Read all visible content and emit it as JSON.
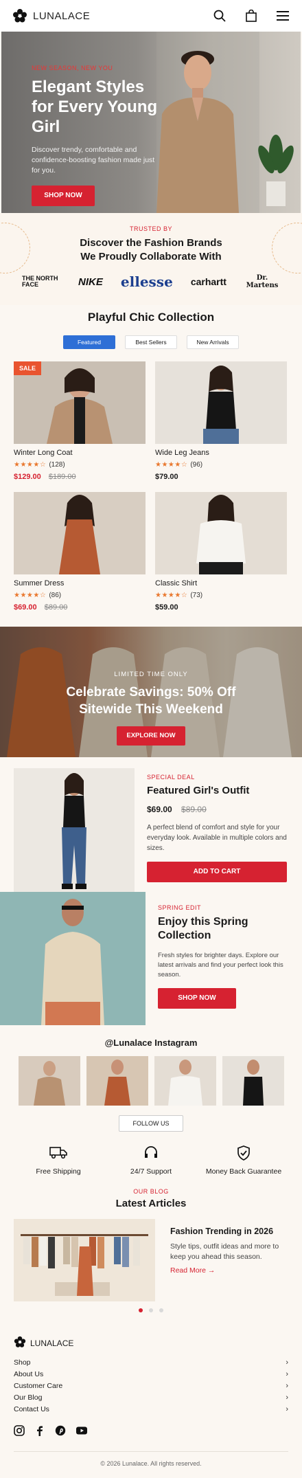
{
  "header": {
    "brand": "LUNALACE",
    "icons": [
      "flower-logo-icon",
      "search-icon",
      "bag-icon",
      "menu-icon"
    ]
  },
  "hero": {
    "eyebrow": "NEW SEASON, NEW YOU",
    "title_line1": "Elegant Styles",
    "title_line2": "for Every Young Girl",
    "description": "Discover trendy, comfortable and confidence-boosting fashion made just for you.",
    "button": "SHOP NOW"
  },
  "brands": {
    "eyebrow": "TRUSTED BY",
    "title_line1": "Discover the Fashion Brands",
    "title_line2": "We Proudly Collaborate With",
    "items": [
      "THE NORTH FACE",
      "NIKE",
      "ellesse",
      "carhartt",
      "Dr. Martens"
    ]
  },
  "collection": {
    "title": "Playful Chic Collection",
    "tabs": [
      "Featured",
      "Best Sellers",
      "New Arrivals"
    ],
    "active_tab": "Featured",
    "products": [
      {
        "name": "Winter Long Coat",
        "rating_count": "(128)",
        "price": "$129.00",
        "old_price": "$189.00",
        "badge": "SALE",
        "stars": 4.5
      },
      {
        "name": "Wide Leg Jeans",
        "rating_count": "(96)",
        "price": "$79.00",
        "old_price": "",
        "badge": "",
        "stars": 4.5
      },
      {
        "name": "Summer Dress",
        "rating_count": "(86)",
        "price": "$69.00",
        "old_price": "$89.00",
        "badge": "",
        "stars": 4.5
      },
      {
        "name": "Classic Shirt",
        "rating_count": "(73)",
        "price": "$59.00",
        "old_price": "",
        "badge": "",
        "stars": 4.5
      }
    ]
  },
  "promo": {
    "eyebrow": "LIMITED TIME ONLY",
    "title_line1": "Celebrate Savings: 50% Off",
    "title_line2": "Sitewide This Weekend",
    "button": "EXPLORE NOW"
  },
  "featured": {
    "eyebrow": "SPECIAL DEAL",
    "title": "Featured Girl's Outfit",
    "price": "$69.00",
    "old_price": "$89.00",
    "description": "A perfect blend of comfort and style for your everyday look. Available in multiple colors and sizes.",
    "button": "ADD TO CART"
  },
  "spring": {
    "eyebrow": "SPRING EDIT",
    "title": "Enjoy this Spring Collection",
    "description": "Fresh styles for brighter days. Explore our latest arrivals and find your perfect look this season.",
    "button": "SHOP NOW"
  },
  "instagram": {
    "title": "@Lunalace Instagram",
    "button": "FOLLOW US"
  },
  "features": [
    {
      "label": "Free Shipping",
      "icon": "truck-icon"
    },
    {
      "label": "24/7 Support",
      "icon": "headset-icon"
    },
    {
      "label": "Money Back Guarantee",
      "icon": "shield-check-icon"
    }
  ],
  "blog": {
    "eyebrow": "OUR BLOG",
    "title": "Latest Articles",
    "card_title": "Fashion Trending in 2026",
    "card_desc": "Style tips, outfit ideas and more to keep you ahead this season.",
    "read_more": "Read More →"
  },
  "footer": {
    "brand": "LUNALACE",
    "links": [
      "Shop",
      "About Us",
      "Customer Care",
      "Our Blog",
      "Contact Us"
    ],
    "socials": [
      "instagram-icon",
      "facebook-icon",
      "pinterest-icon",
      "youtube-icon"
    ],
    "copyright": "© 2026 Lunalace. All rights reserved."
  },
  "colors": {
    "accent": "#d62231",
    "tab_active": "#2e6fd6",
    "star": "#e9782f",
    "sale_badge": "#e9542f",
    "background": "#fbf7f2"
  }
}
